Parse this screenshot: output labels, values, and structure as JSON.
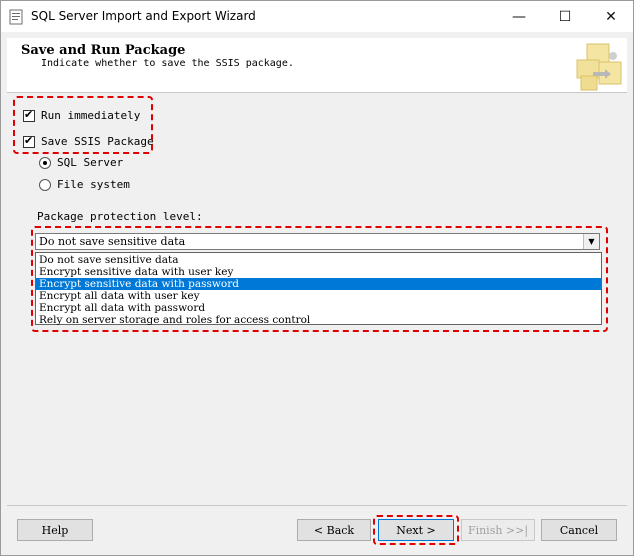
{
  "window": {
    "title": "SQL Server Import and Export Wizard",
    "minimize": "—",
    "maximize": "☐",
    "close": "✕"
  },
  "header": {
    "title": "Save and Run Package",
    "subtitle": "Indicate whether to save the SSIS package."
  },
  "options": {
    "run_immediately": {
      "label": "Run immediately",
      "checked": true
    },
    "save_ssis_package": {
      "label": "Save SSIS Package",
      "checked": true
    },
    "storage": [
      {
        "label": "SQL Server",
        "selected": true
      },
      {
        "label": "File system",
        "selected": false
      }
    ]
  },
  "protection": {
    "label": "Package protection level:",
    "selected_value": "Do not save sensitive data",
    "list": [
      "Do not save sensitive data",
      "Encrypt sensitive data with user key",
      "Encrypt sensitive data with password",
      "Encrypt all data with user key",
      "Encrypt all data with password",
      "Rely on server storage and roles for access control"
    ],
    "highlighted_index": 2
  },
  "buttons": {
    "help": "Help",
    "back": "< Back",
    "next": "Next >",
    "finish": "Finish >>|",
    "cancel": "Cancel"
  },
  "colors": {
    "selection": "#0078d7",
    "annotation": "#e00000"
  }
}
